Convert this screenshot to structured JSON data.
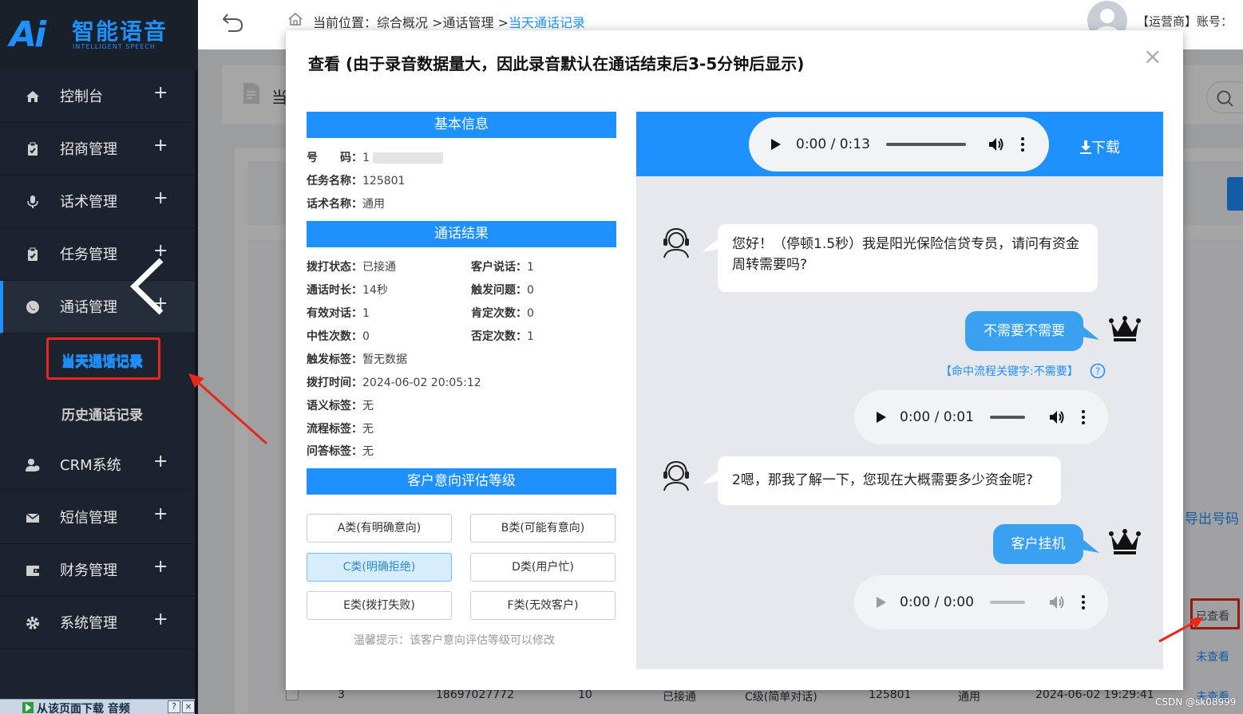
{
  "sidebar": {
    "logo_ai": "Ai",
    "logo_cn": "智能语音",
    "logo_en": "INTELLIGENT SPEECH",
    "items": [
      {
        "label": "控制台",
        "icon": "home-icon"
      },
      {
        "label": "招商管理",
        "icon": "clipboard-icon"
      },
      {
        "label": "话术管理",
        "icon": "microphone-icon"
      },
      {
        "label": "任务管理",
        "icon": "clipboard-icon"
      },
      {
        "label": "通话管理",
        "icon": "phone-icon"
      },
      {
        "label": "CRM系统",
        "icon": "users-icon"
      },
      {
        "label": "短信管理",
        "icon": "mail-icon"
      },
      {
        "label": "财务管理",
        "icon": "wallet-icon"
      },
      {
        "label": "系统管理",
        "icon": "gear-icon"
      }
    ],
    "plus": "+",
    "sub_items": [
      "当天通话记录",
      "历史通话记录"
    ],
    "footer_text": "从该页面下载 音频"
  },
  "topbar": {
    "crumb_prefix": "当前位置：",
    "crumb_1": "综合概况",
    "crumb_2": "通话管理",
    "crumb_3": "当天通话记录",
    "sep": ">",
    "account": "【运营商】账号："
  },
  "background": {
    "page_title_stub": "当",
    "export_label": "导出号码",
    "viewed": "已查看",
    "unviewed": "未查看",
    "row": [
      "3",
      "18697027772",
      "10",
      "已接通",
      "C级(简单对话)",
      "125801",
      "通用",
      "2024-06-02 19:29:41"
    ]
  },
  "modal": {
    "title": "查看 (由于录音数据量大，因此录音默认在通话结束后3-5分钟后显示)",
    "close": "×",
    "basic_head": "基本信息",
    "number_label": "号　　码：",
    "number_value": "1",
    "task_label": "任务名称：",
    "task_value": "125801",
    "script_label": "话术名称：",
    "script_value": "通用",
    "result_head": "通话结果",
    "results_left": [
      {
        "label": "拨打状态：",
        "value": "已接通"
      },
      {
        "label": "通话时长：",
        "value": "14秒"
      },
      {
        "label": "有效对话：",
        "value": "1"
      },
      {
        "label": "中性次数：",
        "value": "0"
      },
      {
        "label": "触发标签：",
        "value": "暂无数据"
      },
      {
        "label": "拨打时间：",
        "value": "2024-06-02 20:05:12"
      },
      {
        "label": "语义标签：",
        "value": "无"
      },
      {
        "label": "流程标签：",
        "value": "无"
      },
      {
        "label": "问答标签：",
        "value": "无"
      }
    ],
    "results_right": [
      {
        "label": "客户说话：",
        "value": "1"
      },
      {
        "label": "触发问题：",
        "value": "0"
      },
      {
        "label": "肯定次数：",
        "value": "0"
      },
      {
        "label": "否定次数：",
        "value": "1"
      }
    ],
    "intent_head": "客户意向评估等级",
    "grades": [
      "A类(有明确意向)",
      "B类(可能有意向)",
      "C类(明确拒绝)",
      "D类(用户忙)",
      "E类(拨打失败)",
      "F类(无效客户)"
    ],
    "selected_grade": "C类(明确拒绝)",
    "hint": "温馨提示：该客户意向评估等级可以修改",
    "main_player_time": "0:00 / 0:13",
    "download": "下载",
    "messages": [
      {
        "side": "bot",
        "text": "您好！（停顿1.5秒）我是阳光保险信贷专员，请问有资金周转需要吗?"
      },
      {
        "side": "user",
        "text": "不需要不需要",
        "hit": "【命中流程关键字:不需要】",
        "player_time": "0:00 / 0:01"
      },
      {
        "side": "bot",
        "text": "2嗯，那我了解一下，您现在大概需要多少资金呢?"
      },
      {
        "side": "user",
        "text": "客户挂机",
        "player_time": "0:00 / 0:00"
      }
    ]
  },
  "watermark": "CSDN @sk08999",
  "colors": {
    "accent": "#1e90ff",
    "sidebar": "#1d232e",
    "highlight": "#e8281c"
  }
}
